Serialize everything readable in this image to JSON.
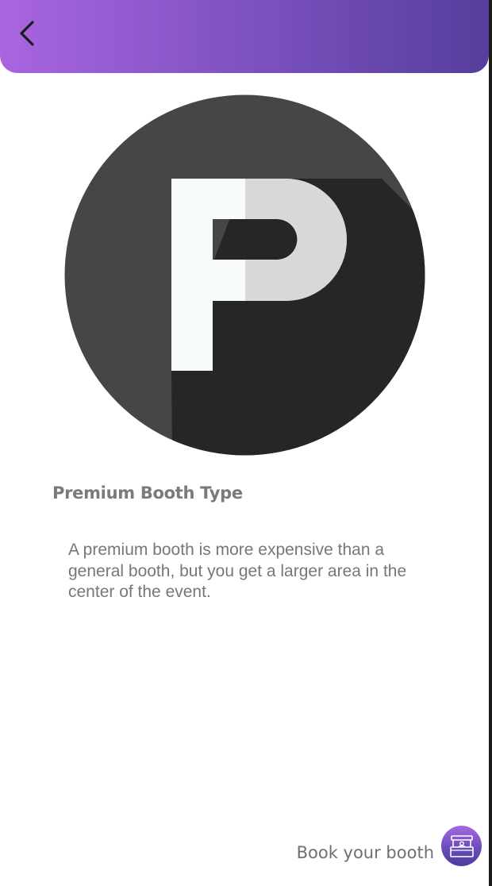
{
  "header": {
    "back_icon": "chevron-left-icon",
    "gradient": [
      "#a965e0",
      "#553e9c"
    ]
  },
  "booth": {
    "logo_letter": "P",
    "logo_icon": "premium-parking-p-icon",
    "title": "Premium Booth Type",
    "description": "A premium booth is more expensive than a general booth, but you get a larger area in the center of the event."
  },
  "cta": {
    "label": "Book your booth",
    "icon": "booth-stand-icon"
  },
  "colors": {
    "accent": "#7e52c0",
    "text_muted": "#777777",
    "logo_dark": "#464646",
    "logo_shadow": "#262626",
    "logo_light": "#f7fcf9"
  }
}
